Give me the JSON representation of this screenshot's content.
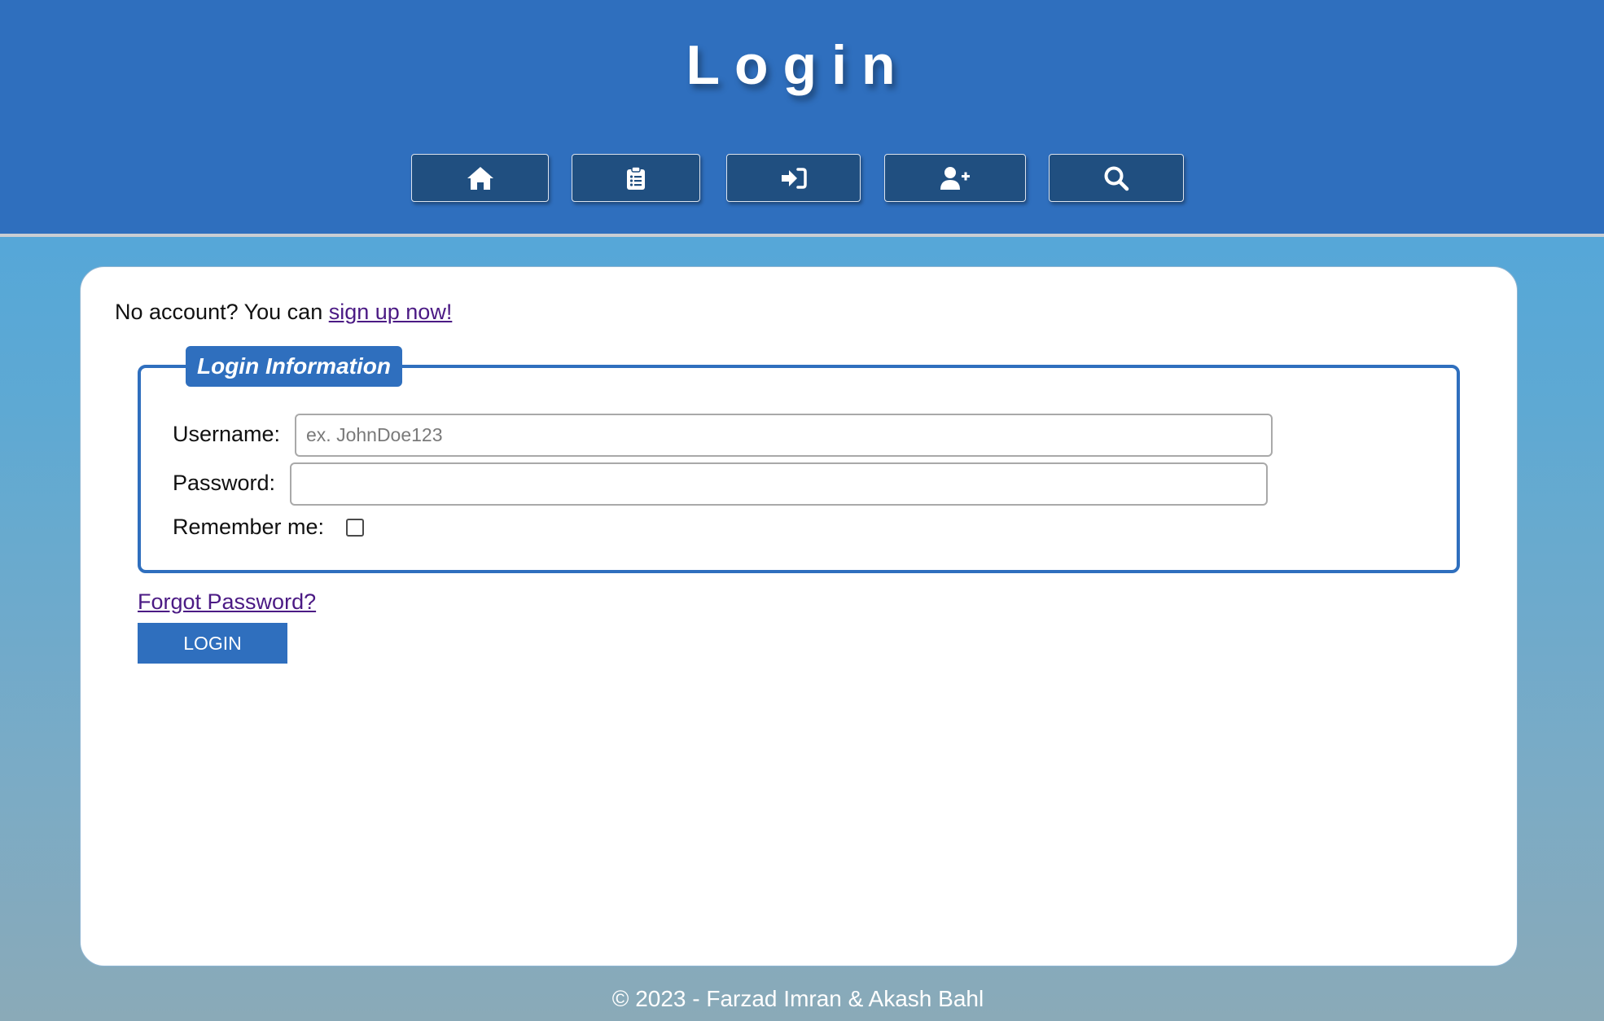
{
  "header": {
    "title": "Login",
    "nav": [
      {
        "icon": "home-icon",
        "label": "Home"
      },
      {
        "icon": "clipboard-list-icon",
        "label": "List"
      },
      {
        "icon": "sign-in-icon",
        "label": "Login"
      },
      {
        "icon": "user-plus-icon",
        "label": "Sign Up"
      },
      {
        "icon": "search-icon",
        "label": "Search"
      }
    ]
  },
  "signup": {
    "prefix": "No account? You can ",
    "link": "sign up now!"
  },
  "form": {
    "legend": "Login Information",
    "username_label": "Username:",
    "username_placeholder": "ex. JohnDoe123",
    "username_value": "",
    "password_label": "Password:",
    "password_value": "",
    "remember_label": "Remember me:",
    "remember_checked": false,
    "forgot_link": "Forgot Password?",
    "login_button": "LOGIN"
  },
  "footer": {
    "text": "© 2023 - Farzad Imran & Akash Bahl"
  },
  "colors": {
    "header_bg": "#2f6fbe",
    "nav_button_bg": "#204f80",
    "accent": "#2f6fbe",
    "link": "#4b1a84"
  }
}
